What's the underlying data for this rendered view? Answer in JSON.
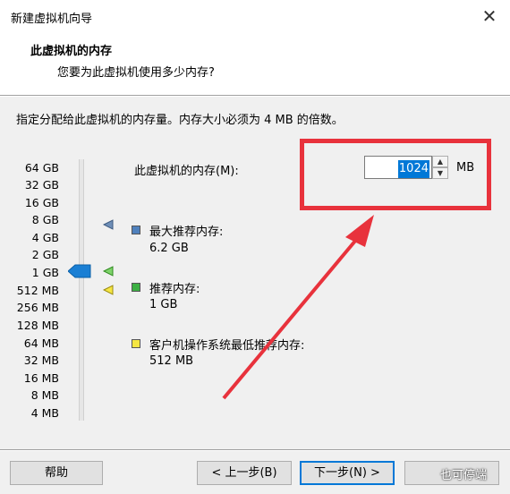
{
  "window": {
    "title": "新建虚拟机向导",
    "close_glyph": "✕"
  },
  "header": {
    "title": "此虚拟机的内存",
    "subtitle": "您要为此虚拟机使用多少内存?"
  },
  "instruction": "指定分配给此虚拟机的内存量。内存大小必须为 4 MB 的倍数。",
  "scale": {
    "labels": [
      "64 GB",
      "32 GB",
      "16 GB",
      "8 GB",
      "4 GB",
      "2 GB",
      "1 GB",
      "512 MB",
      "256 MB",
      "128 MB",
      "64 MB",
      "32 MB",
      "16 MB",
      "8 MB",
      "4 MB"
    ],
    "selected": "1 GB"
  },
  "memory": {
    "label": "此虚拟机的内存(M):",
    "value": "1024",
    "unit": "MB"
  },
  "recommendations": [
    {
      "title": "最大推荐内存:",
      "value": "6.2 GB",
      "color": "#4f81bd"
    },
    {
      "title": "推荐内存:",
      "value": "1 GB",
      "color": "#3cb043"
    },
    {
      "title": "客户机操作系统最低推荐内存:",
      "value": "512 MB",
      "color": "#f5e642"
    }
  ],
  "buttons": {
    "help": "帮助",
    "back": "< 上一步(B)",
    "next": "下一步(N) >"
  },
  "watermark": "也可停端",
  "colors": {
    "annotation_red": "#e8323c",
    "accent": "#0078d7"
  }
}
